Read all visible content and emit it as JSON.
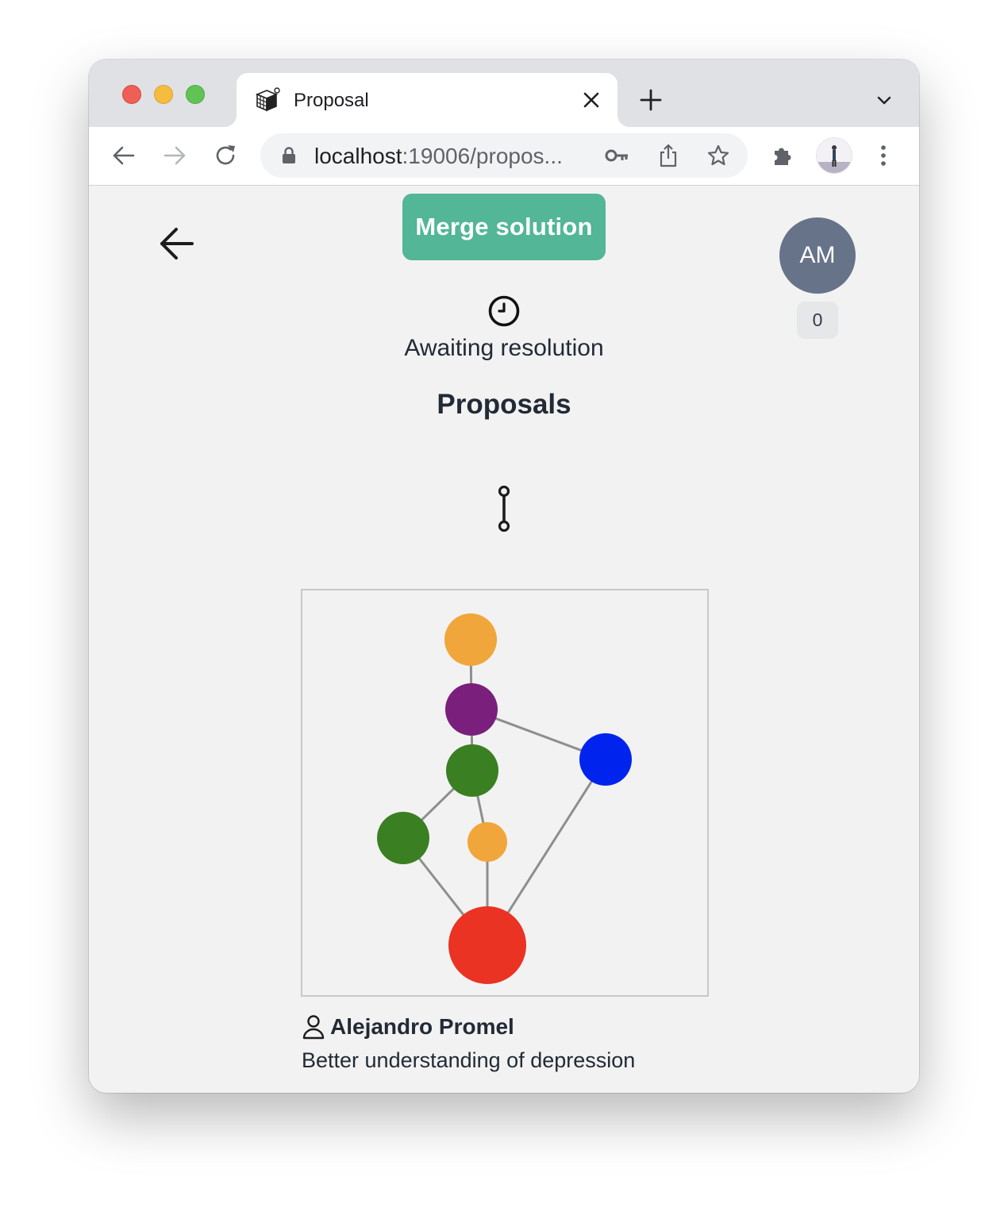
{
  "browser": {
    "tab_title": "Proposal",
    "url_host": "localhost",
    "url_rest": ":19006/propos..."
  },
  "header": {
    "merge_button_label": "Merge solution",
    "user_initials": "AM",
    "count": "0"
  },
  "status": {
    "icon": "clock-icon",
    "text": "Awaiting resolution"
  },
  "section": {
    "title": "Proposals"
  },
  "graph": {
    "nodes": [
      {
        "id": "n1",
        "color": "#f1a63b"
      },
      {
        "id": "n2",
        "color": "#7a1f7c"
      },
      {
        "id": "n3",
        "color": "#3a7f22"
      },
      {
        "id": "n4",
        "color": "#0024ee"
      },
      {
        "id": "n5",
        "color": "#3a7f22"
      },
      {
        "id": "n6",
        "color": "#f1a63b"
      },
      {
        "id": "n7",
        "color": "#ea3323"
      }
    ],
    "edges": [
      [
        "n1",
        "n2"
      ],
      [
        "n2",
        "n3"
      ],
      [
        "n2",
        "n4"
      ],
      [
        "n3",
        "n5"
      ],
      [
        "n3",
        "n6"
      ],
      [
        "n5",
        "n7"
      ],
      [
        "n6",
        "n7"
      ],
      [
        "n4",
        "n7"
      ]
    ],
    "edge_color": "#8e8e8e"
  },
  "proposal": {
    "author": "Alejandro Promel",
    "description": "Better understanding of depression"
  },
  "colors": {
    "accent": "#52b697",
    "avatar_bg": "#677389",
    "page_bg": "#f2f2f2"
  }
}
